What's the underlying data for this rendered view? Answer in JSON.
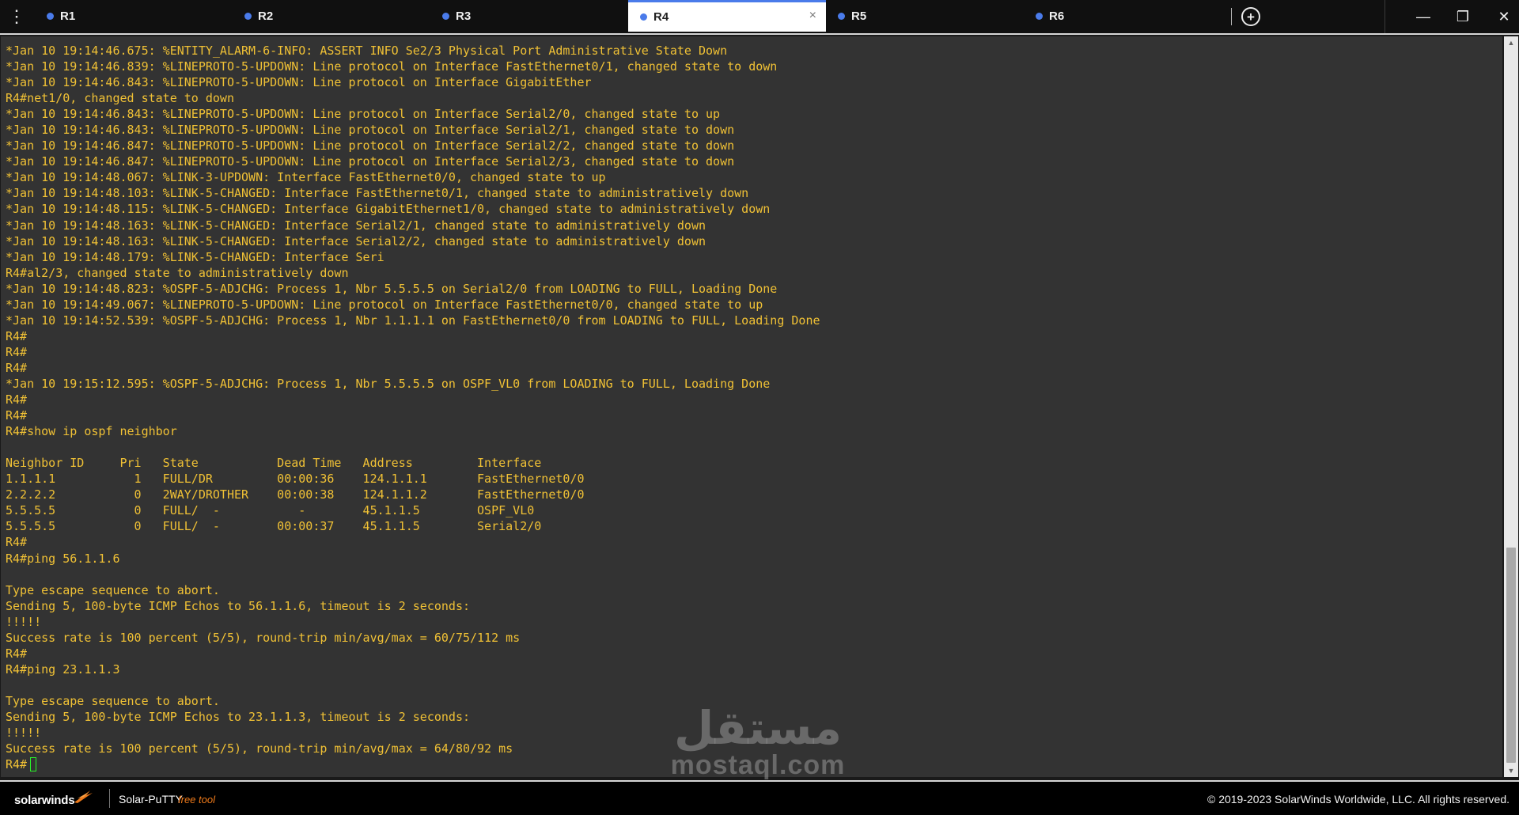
{
  "tabs": [
    {
      "label": "R1",
      "active": false
    },
    {
      "label": "R2",
      "active": false
    },
    {
      "label": "R3",
      "active": false
    },
    {
      "label": "R4",
      "active": true
    },
    {
      "label": "R5",
      "active": false
    },
    {
      "label": "R6",
      "active": false
    }
  ],
  "tab_close_glyph": "×",
  "menu_glyph": "⋮",
  "add_tab_glyph": "+",
  "window_controls": {
    "minimize": "—",
    "restore": "❐",
    "close": "✕"
  },
  "terminal": {
    "lines": [
      "*Jan 10 19:14:46.675: %ENTITY_ALARM-6-INFO: ASSERT INFO Se2/3 Physical Port Administrative State Down",
      "*Jan 10 19:14:46.839: %LINEPROTO-5-UPDOWN: Line protocol on Interface FastEthernet0/1, changed state to down",
      "*Jan 10 19:14:46.843: %LINEPROTO-5-UPDOWN: Line protocol on Interface GigabitEther",
      "R4#net1/0, changed state to down",
      "*Jan 10 19:14:46.843: %LINEPROTO-5-UPDOWN: Line protocol on Interface Serial2/0, changed state to up",
      "*Jan 10 19:14:46.843: %LINEPROTO-5-UPDOWN: Line protocol on Interface Serial2/1, changed state to down",
      "*Jan 10 19:14:46.847: %LINEPROTO-5-UPDOWN: Line protocol on Interface Serial2/2, changed state to down",
      "*Jan 10 19:14:46.847: %LINEPROTO-5-UPDOWN: Line protocol on Interface Serial2/3, changed state to down",
      "*Jan 10 19:14:48.067: %LINK-3-UPDOWN: Interface FastEthernet0/0, changed state to up",
      "*Jan 10 19:14:48.103: %LINK-5-CHANGED: Interface FastEthernet0/1, changed state to administratively down",
      "*Jan 10 19:14:48.115: %LINK-5-CHANGED: Interface GigabitEthernet1/0, changed state to administratively down",
      "*Jan 10 19:14:48.163: %LINK-5-CHANGED: Interface Serial2/1, changed state to administratively down",
      "*Jan 10 19:14:48.163: %LINK-5-CHANGED: Interface Serial2/2, changed state to administratively down",
      "*Jan 10 19:14:48.179: %LINK-5-CHANGED: Interface Seri",
      "R4#al2/3, changed state to administratively down",
      "*Jan 10 19:14:48.823: %OSPF-5-ADJCHG: Process 1, Nbr 5.5.5.5 on Serial2/0 from LOADING to FULL, Loading Done",
      "*Jan 10 19:14:49.067: %LINEPROTO-5-UPDOWN: Line protocol on Interface FastEthernet0/0, changed state to up",
      "*Jan 10 19:14:52.539: %OSPF-5-ADJCHG: Process 1, Nbr 1.1.1.1 on FastEthernet0/0 from LOADING to FULL, Loading Done",
      "R4#",
      "R4#",
      "R4#",
      "*Jan 10 19:15:12.595: %OSPF-5-ADJCHG: Process 1, Nbr 5.5.5.5 on OSPF_VL0 from LOADING to FULL, Loading Done",
      "R4#",
      "R4#",
      "R4#show ip ospf neighbor",
      "",
      "Neighbor ID     Pri   State           Dead Time   Address         Interface",
      "1.1.1.1           1   FULL/DR         00:00:36    124.1.1.1       FastEthernet0/0",
      "2.2.2.2           0   2WAY/DROTHER    00:00:38    124.1.1.2       FastEthernet0/0",
      "5.5.5.5           0   FULL/  -           -        45.1.1.5        OSPF_VL0",
      "5.5.5.5           0   FULL/  -        00:00:37    45.1.1.5        Serial2/0",
      "R4#",
      "R4#ping 56.1.1.6",
      "",
      "Type escape sequence to abort.",
      "Sending 5, 100-byte ICMP Echos to 56.1.1.6, timeout is 2 seconds:",
      "!!!!!",
      "Success rate is 100 percent (5/5), round-trip min/avg/max = 60/75/112 ms",
      "R4#",
      "R4#ping 23.1.1.3",
      "",
      "Type escape sequence to abort.",
      "Sending 5, 100-byte ICMP Echos to 23.1.1.3, timeout is 2 seconds:",
      "!!!!!",
      "Success rate is 100 percent (5/5), round-trip min/avg/max = 64/80/92 ms",
      "R4#"
    ],
    "text_color": "#f0c135",
    "background": "#333333",
    "cursor_color": "#29f329"
  },
  "watermark": {
    "arabic": "مستقل",
    "latin": "mostaql.com"
  },
  "footer": {
    "brand": "solarwinds",
    "product": "Solar-PuTTY",
    "tagline": "free tool",
    "copyright": "© 2019-2023 SolarWinds Worldwide, LLC. All rights reserved."
  },
  "colors": {
    "accent": "#4a7bea",
    "tagline": "#ef7a1a"
  }
}
